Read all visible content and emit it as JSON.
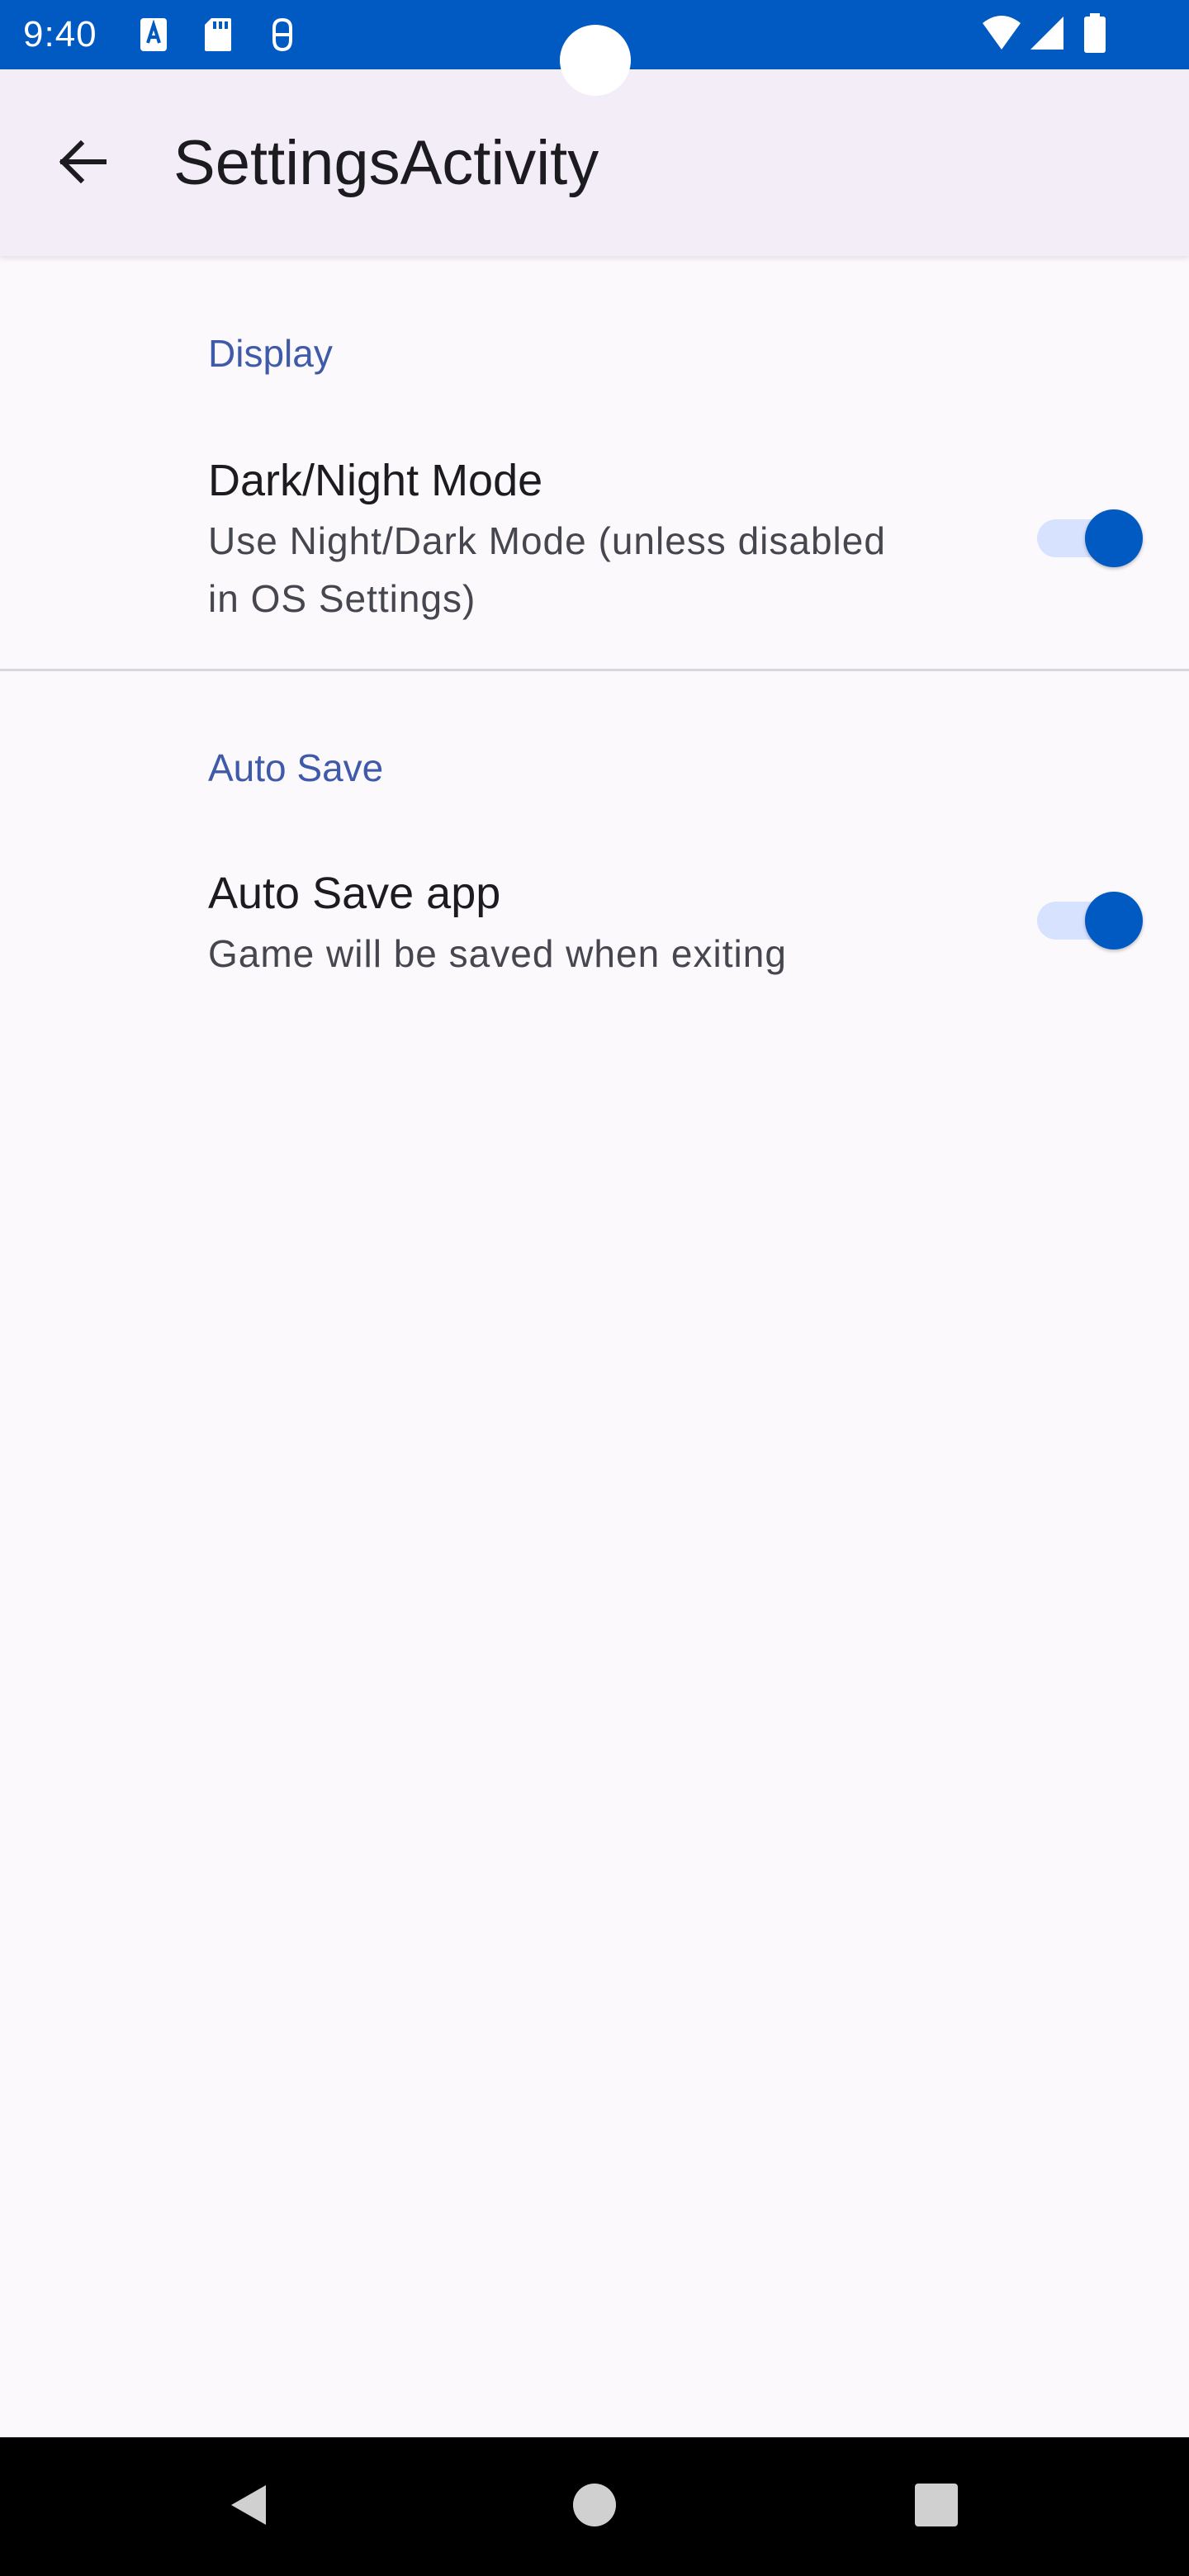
{
  "status_bar": {
    "time": "9:40",
    "left_icons": [
      "font-a-icon",
      "sd-card-icon",
      "bug-icon"
    ],
    "right_icons": [
      "wifi-icon",
      "signal-icon",
      "battery-icon"
    ],
    "color": "#005ac1"
  },
  "app_bar": {
    "title": "SettingsActivity",
    "back_icon": "arrow-back-icon"
  },
  "preferences": {
    "display": {
      "category": "Display",
      "dark_mode": {
        "title": "Dark/Night Mode",
        "summary_line1": "Use Night/Dark Mode (unless disabled",
        "summary_line2": "in OS Settings)",
        "enabled": true
      }
    },
    "auto_save": {
      "category": "Auto Save",
      "auto_save_app": {
        "title": "Auto Save app",
        "summary": "Game will be saved when exiting",
        "enabled": true
      }
    }
  },
  "nav_bar": {
    "back_icon": "nav-back-icon",
    "home_icon": "nav-home-icon",
    "recents_icon": "nav-recents-icon"
  },
  "colors": {
    "accent": "#005ac1",
    "category_text": "#3f5aa8",
    "background": "#fcf9fd",
    "app_bar": "#f2edf6"
  }
}
